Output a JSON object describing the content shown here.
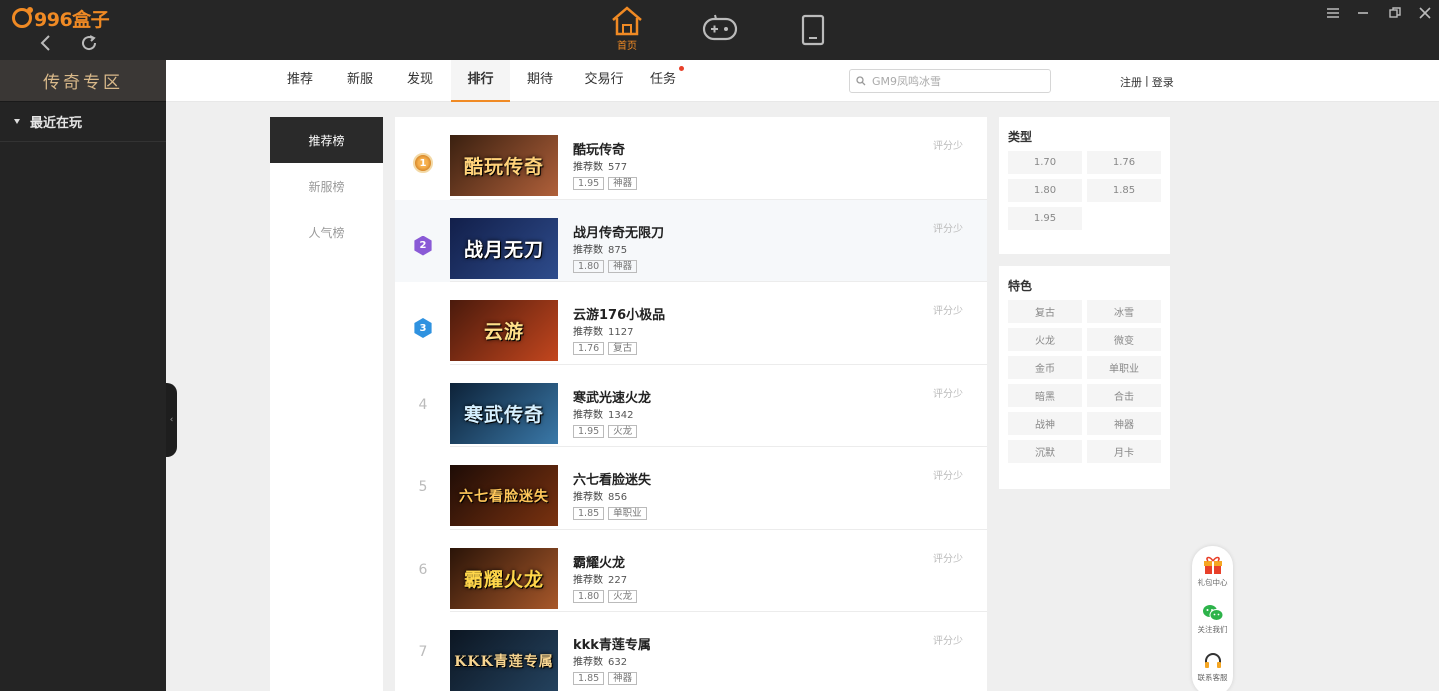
{
  "app": {
    "logo_text": "996盒子"
  },
  "top_nav": [
    {
      "name": "home-icon",
      "label": "首页",
      "active": true
    },
    {
      "name": "gamepad-icon",
      "label": ""
    },
    {
      "name": "tablet-icon",
      "label": ""
    }
  ],
  "sidebar": {
    "title": "传奇专区",
    "recent_label": "最近在玩"
  },
  "tabs": [
    {
      "label": "推荐",
      "active": false
    },
    {
      "label": "新服",
      "active": false
    },
    {
      "label": "发现",
      "active": false
    },
    {
      "label": "排行",
      "active": true
    },
    {
      "label": "期待",
      "active": false
    },
    {
      "label": "交易行",
      "active": false
    },
    {
      "label": "任务",
      "active": false,
      "badge": true
    }
  ],
  "search": {
    "placeholder": "GM9凤鸣冰雪"
  },
  "auth": {
    "register": "注册",
    "separator": "|",
    "login": "登录"
  },
  "rank_tabs": [
    {
      "label": "推荐榜",
      "active": true
    },
    {
      "label": "新服榜",
      "active": false
    },
    {
      "label": "人气榜",
      "active": false
    }
  ],
  "games": [
    {
      "rank": "1",
      "name": "酷玩传奇",
      "stat_label": "推荐数",
      "stat_value": "577",
      "tags": [
        "1.95",
        "神器"
      ],
      "score": "评分少",
      "thumb_text": "酷玩传奇",
      "thumb_colors": [
        "#3a2010",
        "#b0603a"
      ],
      "thumb_text_color": "#ffd27a"
    },
    {
      "rank": "2",
      "name": "战月传奇无限刀",
      "stat_label": "推荐数",
      "stat_value": "875",
      "tags": [
        "1.80",
        "神器"
      ],
      "score": "评分少",
      "thumb_text": "战月无刀",
      "thumb_colors": [
        "#121f4a",
        "#2e4c8c"
      ],
      "thumb_text_color": "#ffffff"
    },
    {
      "rank": "3",
      "name": "云游176小极品",
      "stat_label": "推荐数",
      "stat_value": "1127",
      "tags": [
        "1.76",
        "复古"
      ],
      "score": "评分少",
      "thumb_text": "云游",
      "thumb_colors": [
        "#4a1a0c",
        "#c3461e"
      ],
      "thumb_text_color": "#ffe08a"
    },
    {
      "rank": "4",
      "name": "寒武光速火龙",
      "stat_label": "推荐数",
      "stat_value": "1342",
      "tags": [
        "1.95",
        "火龙"
      ],
      "score": "评分少",
      "thumb_text": "寒武传奇",
      "thumb_colors": [
        "#0d2238",
        "#3a78a8"
      ],
      "thumb_text_color": "#d6f0ff"
    },
    {
      "rank": "5",
      "name": "六七看脸迷失",
      "stat_label": "推荐数",
      "stat_value": "856",
      "tags": [
        "1.85",
        "单职业"
      ],
      "score": "评分少",
      "thumb_text": "六七看脸迷失",
      "thumb_colors": [
        "#1e0c06",
        "#7a3210"
      ],
      "thumb_text_color": "#ffc75a"
    },
    {
      "rank": "6",
      "name": "霸耀火龙",
      "stat_label": "推荐数",
      "stat_value": "227",
      "tags": [
        "1.80",
        "火龙"
      ],
      "score": "评分少",
      "thumb_text": "霸耀火龙",
      "thumb_colors": [
        "#2a1408",
        "#a8582a"
      ],
      "thumb_text_color": "#ffd64a"
    },
    {
      "rank": "7",
      "name": "kkk青莲专属",
      "stat_label": "推荐数",
      "stat_value": "632",
      "tags": [
        "1.85",
        "神器"
      ],
      "score": "评分少",
      "thumb_text": "KKK青莲专属",
      "thumb_colors": [
        "#0c1622",
        "#24425e"
      ],
      "thumb_text_color": "#f6d490"
    }
  ],
  "filters": {
    "type": {
      "title": "类型",
      "items": [
        "1.70",
        "1.76",
        "1.80",
        "1.85",
        "1.95"
      ]
    },
    "feature": {
      "title": "特色",
      "items": [
        "复古",
        "冰雪",
        "火龙",
        "微变",
        "金币",
        "单职业",
        "暗黑",
        "合击",
        "战神",
        "神器",
        "沉默",
        "月卡"
      ]
    }
  },
  "float_tools": [
    {
      "name": "gift-icon",
      "label": "礼包中心"
    },
    {
      "name": "wechat-icon",
      "label": "关注我们"
    },
    {
      "name": "headset-icon",
      "label": "联系客服"
    }
  ],
  "colors": {
    "accent": "#f08a24",
    "topbar": "#262626",
    "sidebar": "#242424",
    "badge": "#e8402a"
  }
}
